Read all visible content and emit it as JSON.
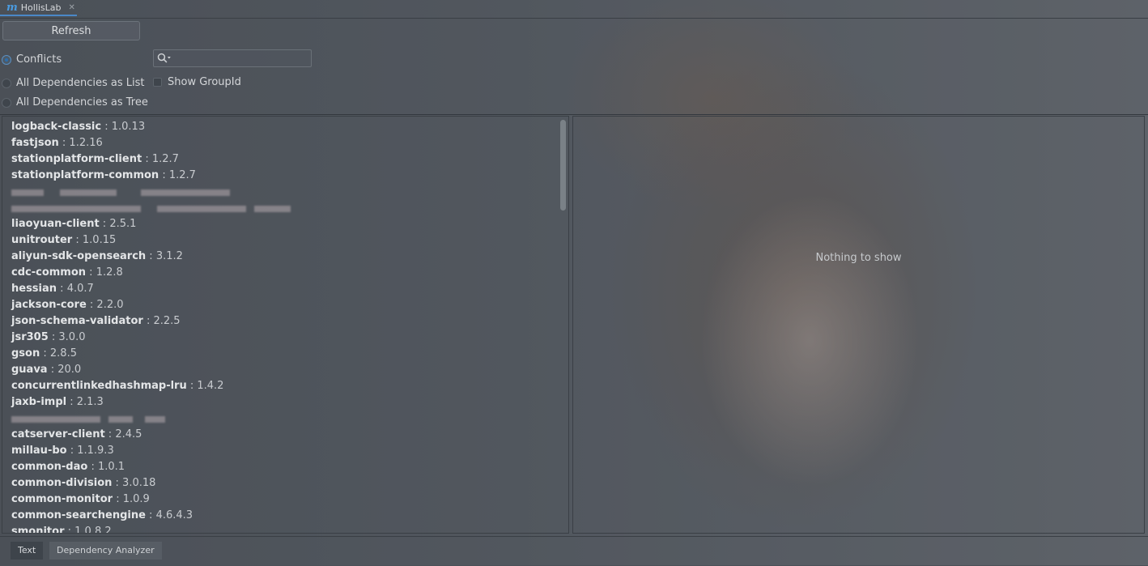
{
  "window": {
    "tab_title": "HollisLab",
    "tab_logo": "m"
  },
  "toolbar": {
    "refresh_label": "Refresh"
  },
  "view_modes": [
    {
      "label": "Conflicts",
      "selected": true
    },
    {
      "label": "All Dependencies as List",
      "selected": false
    },
    {
      "label": "All Dependencies as Tree",
      "selected": false
    }
  ],
  "search": {
    "value": "",
    "placeholder": ""
  },
  "options": {
    "show_group_id_label": "Show GroupId",
    "show_group_id_checked": false
  },
  "dependencies": [
    {
      "name": "logback-classic",
      "version": "1.0.13"
    },
    {
      "name": "fastjson",
      "version": "1.2.16"
    },
    {
      "name": "stationplatform-client",
      "version": "1.2.7"
    },
    {
      "name": "stationplatform-common",
      "version": "1.2.7"
    },
    {
      "redacted": true
    },
    {
      "redacted": true
    },
    {
      "name": "liaoyuan-client",
      "version": "2.5.1"
    },
    {
      "name": "unitrouter",
      "version": "1.0.15"
    },
    {
      "name": "aliyun-sdk-opensearch",
      "version": "3.1.2"
    },
    {
      "name": "cdc-common",
      "version": "1.2.8"
    },
    {
      "name": "hessian",
      "version": "4.0.7"
    },
    {
      "name": "jackson-core",
      "version": "2.2.0"
    },
    {
      "name": "json-schema-validator",
      "version": "2.2.5"
    },
    {
      "name": "jsr305",
      "version": "3.0.0"
    },
    {
      "name": "gson",
      "version": "2.8.5"
    },
    {
      "name": "guava",
      "version": "20.0"
    },
    {
      "name": "concurrentlinkedhashmap-lru",
      "version": "1.4.2"
    },
    {
      "name": "jaxb-impl",
      "version": "2.1.3"
    },
    {
      "redacted": true
    },
    {
      "name": "catserver-client",
      "version": "2.4.5"
    },
    {
      "name": "millau-bo",
      "version": "1.1.9.3"
    },
    {
      "name": "common-dao",
      "version": "1.0.1"
    },
    {
      "name": "common-division",
      "version": "3.0.18"
    },
    {
      "name": "common-monitor",
      "version": "1.0.9"
    },
    {
      "name": "common-searchengine",
      "version": "4.6.4.3"
    },
    {
      "name": "smonitor",
      "version": "1.0.8.2"
    }
  ],
  "detail_panel": {
    "empty_text": "Nothing to show"
  },
  "bottom_tabs": [
    {
      "label": "Text",
      "active": true
    },
    {
      "label": "Dependency Analyzer",
      "active": false
    }
  ],
  "icons": {
    "search": "search-icon",
    "close": "close-icon",
    "logo": "maven-helper-logo-icon"
  },
  "colors": {
    "accent": "#4a88c7",
    "text": "#e3e5e7"
  }
}
